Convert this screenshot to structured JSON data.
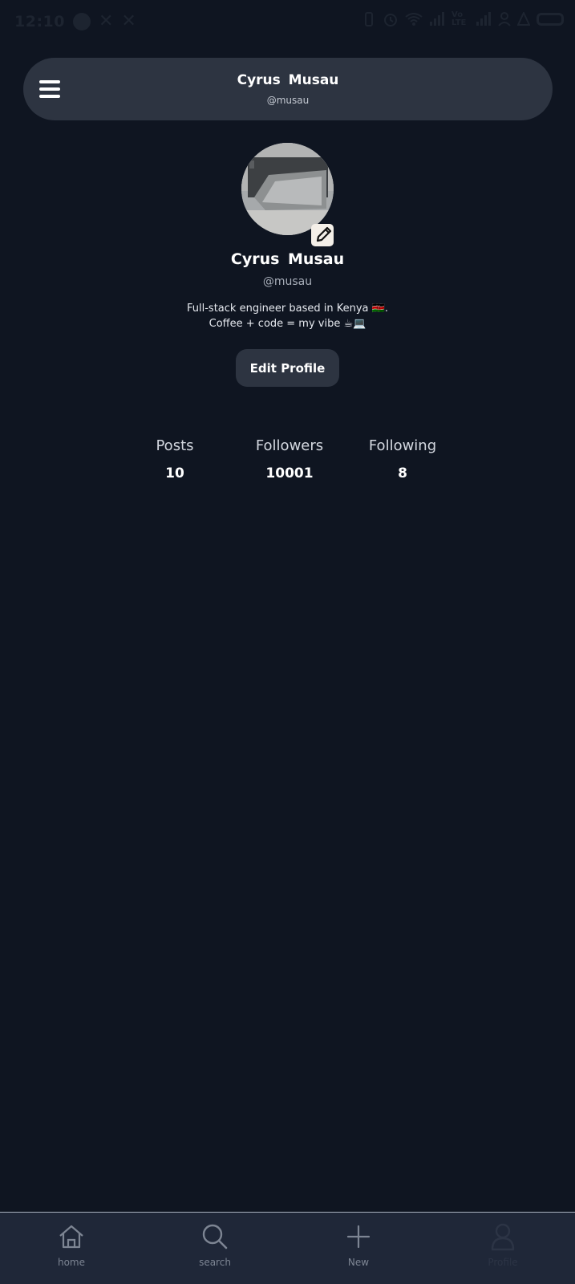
{
  "status_bar": {
    "time": "12:10",
    "notification_icons": [
      "x-app-icon",
      "x-app-icon"
    ],
    "network_label": "Vo LTE"
  },
  "header": {
    "name": "Cyrus Musau",
    "handle": "@musau"
  },
  "profile": {
    "name": "Cyrus Musau",
    "handle": "@musau",
    "bio_line1": "Full-stack engineer based in Kenya 🇰🇪.",
    "bio_line2": "Coffee + code = my vibe ☕💻",
    "edit_button": "Edit Profile"
  },
  "stats": [
    {
      "label": "Posts",
      "value": "10"
    },
    {
      "label": "Followers",
      "value": "10001"
    },
    {
      "label": "Following",
      "value": "8"
    }
  ],
  "nav": [
    {
      "label": "home",
      "icon": "home-icon"
    },
    {
      "label": "search",
      "icon": "search-icon"
    },
    {
      "label": "New",
      "icon": "plus-icon"
    },
    {
      "label": "Profile",
      "icon": "user-icon"
    }
  ],
  "colors": {
    "background": "#0f1521",
    "card": "#2d3441",
    "nav": "#1f2738"
  }
}
